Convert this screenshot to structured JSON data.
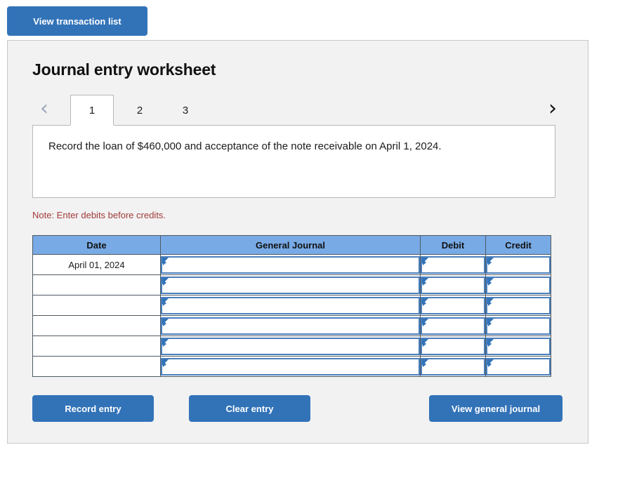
{
  "top_bar": {
    "view_transaction_list_label": "View transaction list"
  },
  "worksheet": {
    "title": "Journal entry worksheet",
    "pager": {
      "prev_icon": "chevron-left-icon",
      "next_icon": "chevron-right-icon",
      "prev_glyph": "‹",
      "next_glyph": "›"
    },
    "tabs": [
      {
        "label": "1",
        "active": true
      },
      {
        "label": "2",
        "active": false
      },
      {
        "label": "3",
        "active": false
      }
    ],
    "instruction": "Record the loan of $460,000 and acceptance of the note receivable on April 1, 2024.",
    "note": "Note: Enter debits before credits."
  },
  "table": {
    "columns": [
      "Date",
      "General Journal",
      "Debit",
      "Credit"
    ],
    "rows": [
      {
        "date": "April 01, 2024",
        "general_journal": "",
        "debit": "",
        "credit": ""
      },
      {
        "date": "",
        "general_journal": "",
        "debit": "",
        "credit": ""
      },
      {
        "date": "",
        "general_journal": "",
        "debit": "",
        "credit": ""
      },
      {
        "date": "",
        "general_journal": "",
        "debit": "",
        "credit": ""
      },
      {
        "date": "",
        "general_journal": "",
        "debit": "",
        "credit": ""
      },
      {
        "date": "",
        "general_journal": "",
        "debit": "",
        "credit": ""
      }
    ]
  },
  "actions": {
    "record_entry_label": "Record entry",
    "clear_entry_label": "Clear entry",
    "view_general_journal_label": "View general journal"
  },
  "colors": {
    "button_blue": "#3273b8",
    "header_blue": "#78aae5",
    "field_border_blue": "#4a7fbc",
    "note_red": "#a33a3a",
    "panel_gray": "#f2f2f2",
    "panel_border": "#c8c8c8"
  }
}
